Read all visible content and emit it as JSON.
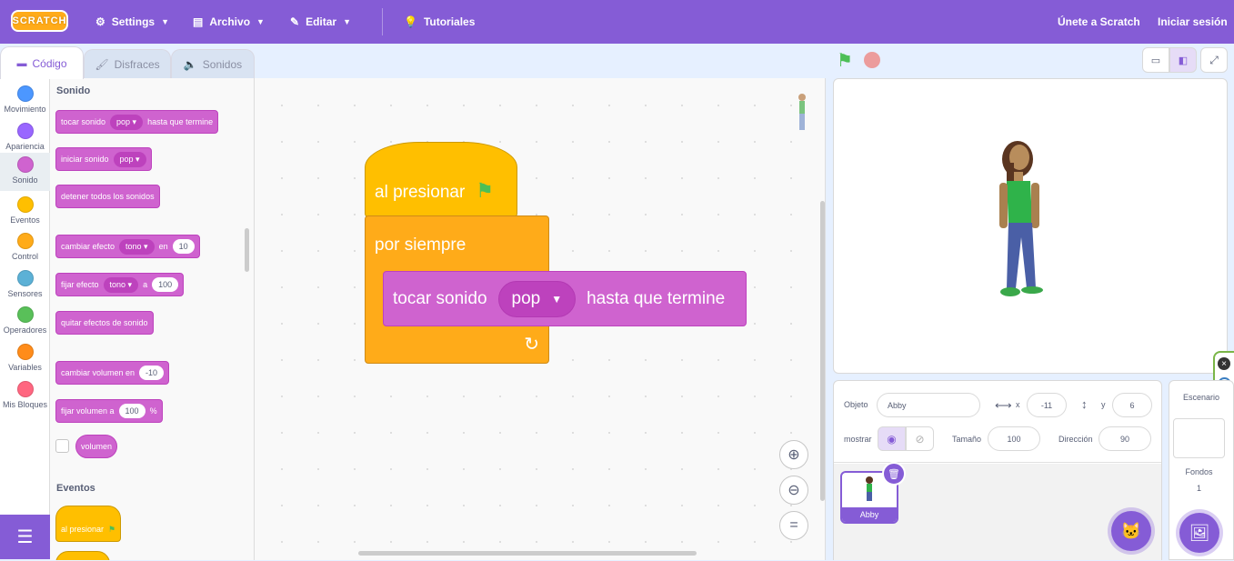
{
  "menu": {
    "logo": "SCRATCH",
    "settings": "Settings",
    "file": "Archivo",
    "edit": "Editar",
    "tutorials": "Tutoriales",
    "join": "Únete a Scratch",
    "signin": "Iniciar sesión"
  },
  "tabs": {
    "code": "Código",
    "costumes": "Disfraces",
    "sounds": "Sonidos"
  },
  "categories": [
    {
      "label": "Movimiento",
      "color": "#4c97ff"
    },
    {
      "label": "Apariencia",
      "color": "#9966ff"
    },
    {
      "label": "Sonido",
      "color": "#cf63cf"
    },
    {
      "label": "Eventos",
      "color": "#ffbf00"
    },
    {
      "label": "Control",
      "color": "#ffab19"
    },
    {
      "label": "Sensores",
      "color": "#5cb1d6"
    },
    {
      "label": "Operadores",
      "color": "#59c059"
    },
    {
      "label": "Variables",
      "color": "#ff8c1a"
    },
    {
      "label": "Mis Bloques",
      "color": "#ff6680"
    }
  ],
  "palette": {
    "sound_heading": "Sonido",
    "events_heading": "Eventos",
    "blocks": {
      "play_until": {
        "pre": "tocar sonido",
        "dd": "pop ▾",
        "post": "hasta que termine"
      },
      "start_sound": {
        "pre": "iniciar sonido",
        "dd": "pop ▾"
      },
      "stop_all": {
        "pre": "detener todos los sonidos"
      },
      "change_effect": {
        "pre": "cambiar efecto",
        "dd": "tono ▾",
        "mid": "en",
        "num": "10"
      },
      "set_effect": {
        "pre": "fijar efecto",
        "dd": "tono ▾",
        "mid": "a",
        "num": "100"
      },
      "clear_effects": {
        "pre": "quitar efectos de sonido"
      },
      "change_volume": {
        "pre": "cambiar volumen en",
        "num": "-10"
      },
      "set_volume": {
        "pre": "fijar volumen a",
        "num": "100",
        "post": "%"
      },
      "volume": {
        "pre": "volumen"
      },
      "when_flag": {
        "pre": "al presionar"
      }
    }
  },
  "script": {
    "hat": "al presionar",
    "forever": "por siempre",
    "sound_pre": "tocar sonido",
    "sound_dd": "pop",
    "sound_post": "hasta que termine"
  },
  "sprite_info": {
    "object_label": "Objeto",
    "name": "Abby",
    "x_label": "x",
    "x": "-11",
    "y_label": "y",
    "y": "6",
    "show_label": "mostrar",
    "size_label": "Tamaño",
    "size": "100",
    "direction_label": "Dirección",
    "direction": "90"
  },
  "sprites": [
    {
      "name": "Abby"
    }
  ],
  "backdrop": {
    "title": "Escenario",
    "label": "Fondos",
    "count": "1"
  },
  "colors": {
    "accent": "#855cd6",
    "sound": "#cf63cf",
    "events": "#ffbf00",
    "control": "#ffab19"
  }
}
